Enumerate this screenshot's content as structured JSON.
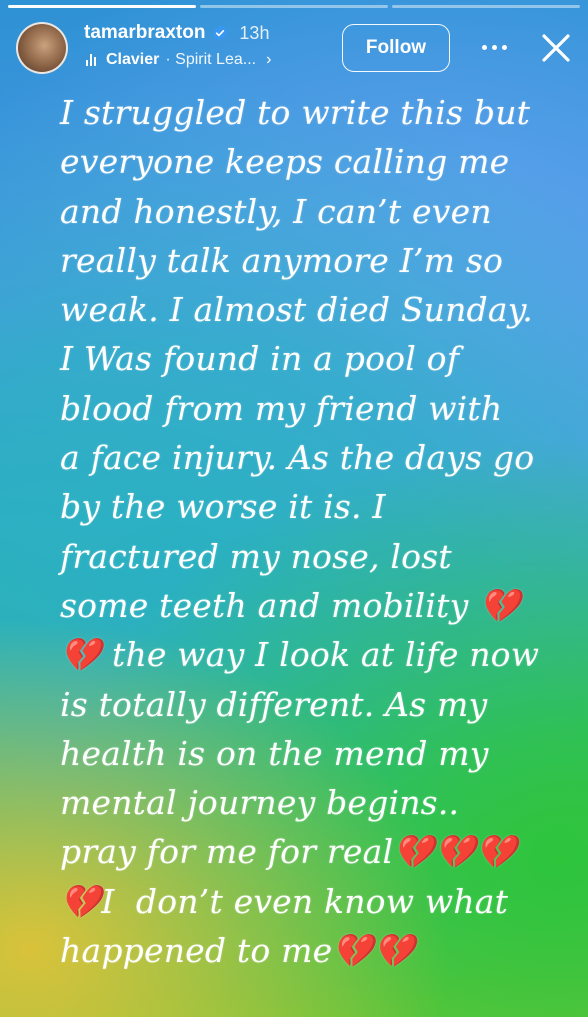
{
  "progress": {
    "segments": 3,
    "active_index": 0
  },
  "header": {
    "username": "tamarbraxton",
    "time": "13h",
    "song": "Clavier",
    "artist": "· Spirit Lea...",
    "chevron": "›",
    "follow_label": "Follow"
  },
  "story_text": "I struggled to write this but\neveryone keeps calling me\nand honestly, I can’t even\nreally talk anymore I’m so\nweak. I almost died Sunday.\nI Was found in a pool of\nblood from my friend with\na face injury. As the days go\nby the worse it is. I\nfractured my nose, lost\nsome teeth and mobility 💔\n💔 the way I look at life now\nis totally different. As my\nhealth is on the mend my\nmental journey begins..\npray for me for real💔💔💔\n💔I  don’t even know what\nhappened to me💔💔",
  "icons": {
    "verified": "verified-badge-icon",
    "music": "music-bars-icon",
    "more": "more-options-icon",
    "close": "close-icon"
  },
  "colors": {
    "verified_blue": "#3897f0",
    "text": "#ffffff"
  }
}
